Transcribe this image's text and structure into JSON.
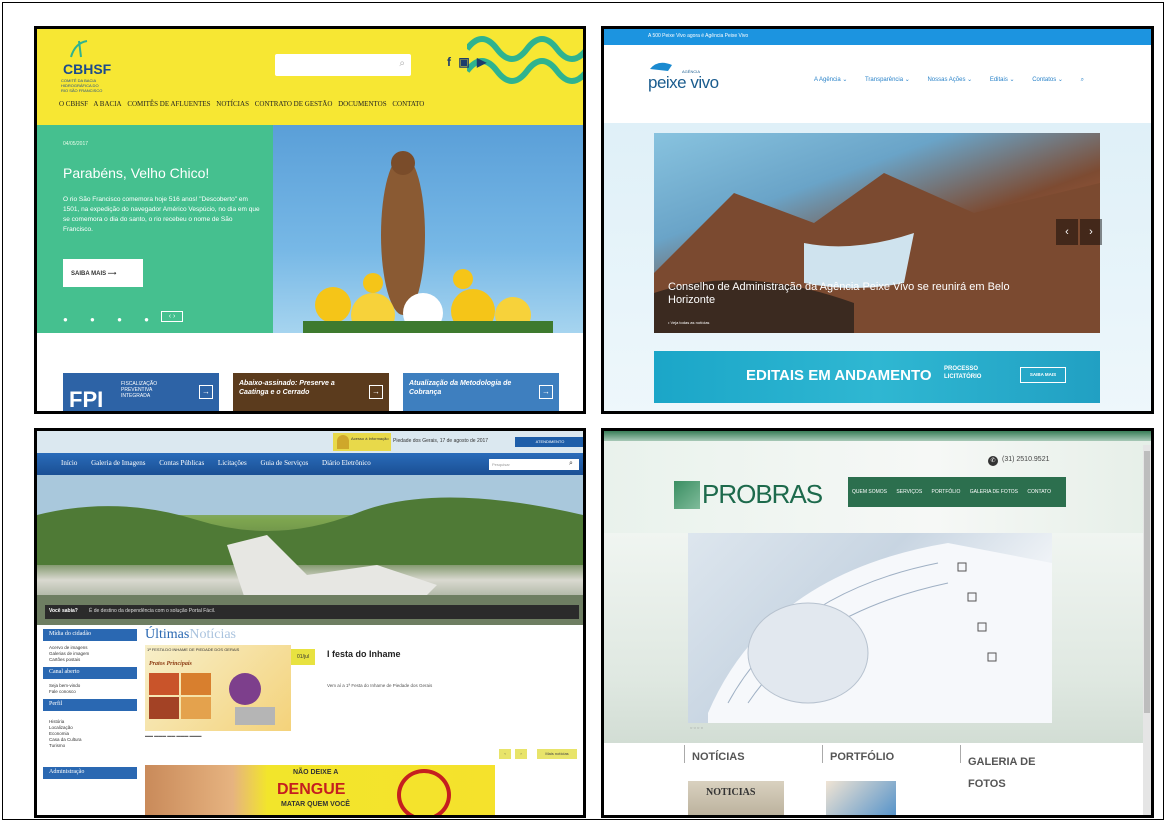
{
  "cbhsf": {
    "logo": "CBHSF",
    "logo_sub": "COMITÊ DA BACIA HIDROGRÁFICA DO RIO SÃO FRANCISCO",
    "social": "f ▣ ▶",
    "nav": [
      "O CBHSF",
      "A BACIA",
      "COMITÊS DE AFLUENTES",
      "NOTÍCIAS",
      "CONTRATO DE GESTÃO",
      "DOCUMENTOS",
      "CONTATO"
    ],
    "slide_date": "04/05/2017",
    "slide_title": "Parabéns, Velho Chico!",
    "slide_text": "O rio São Francisco comemora hoje 516 anos! \"Descoberto\" em 1501, na expedição do navegador Américo Vespúcio, no dia em que se comemora o dia do santo, o rio recebeu o nome de São Francisco.",
    "slide_button": "SAIBA MAIS",
    "slide_dots": "● ● ● ●",
    "slide_arrows": "‹ ›",
    "card1_big": "FPI",
    "card1_small": "FISCALIZAÇÃO PREVENTIVA INTEGRADA",
    "card2_text": "Abaixo-assinado: Preserve a Caatinga e o Cerrado",
    "card3_text": "Atualização da Metodologia de Cobrança"
  },
  "peixevivo": {
    "topbar": "A 500 Peixe Vivo agora é Agência Peixe Vivo",
    "logo_small": "AGÊNCIA",
    "logo": "peixe vivo",
    "nav": [
      "A Agência ⌄",
      "Transparência ⌄",
      "Nossas Ações ⌄",
      "Editais ⌄",
      "Contatos ⌄",
      "⌕"
    ],
    "slide_caption": "Conselho de Administração da Agência Peixe Vivo se reunirá em Belo Horizonte",
    "slide_link": "• Veja todas as notícias",
    "banner_title": "EDITAIS EM ANDAMENTO",
    "banner_sub": "PROCESSO LICITATÓRIO",
    "banner_button": "SAIBA MAIS"
  },
  "piedade": {
    "badge": "Acesso à Informação",
    "date": "Piedade dos Gerais, 17 de agosto de 2017",
    "attend": "ATENDIMENTO",
    "nav": [
      "Início",
      "Galeria de Imagens",
      "Contas Públicas",
      "Licitações",
      "Guia de Serviços",
      "Diário Eletrônico"
    ],
    "search_placeholder": "Pesquisar",
    "bar_question": "Você sabia?",
    "bar_text": "É de destino da dependência com o solução Portal Fácil.",
    "side": [
      {
        "title": "Mídia do cidadão",
        "items": [
          "Acervo de imagens",
          "Galerias de imagem",
          "Cartões postais"
        ]
      },
      {
        "title": "Canal aberto",
        "items": [
          "Seja bem-vindo",
          "Fale conosco"
        ]
      },
      {
        "title": "Perfil",
        "items": [
          "História",
          "Localização",
          "Economia",
          "Casa da Cultura",
          "Turismo"
        ]
      },
      {
        "title": "Administração",
        "items": []
      }
    ],
    "news_title_a": "Últimas",
    "news_title_b": "Notícias",
    "poster_title": "1ª FESTA DO INHAME DE PIEDADE DOS GERAIS",
    "poster_sub": "Pratos Principais",
    "dengue_btn": "01/jul",
    "news_headline": "I festa do Inhame",
    "news_text": "Vem aí a 1ª Festa do Inhame de Piedade dos Gerais",
    "logos": "▬▬ ▬▬▬ ▬▬ ▬▬▬ ▬▬▬",
    "pag_prev": "‹",
    "pag_next": "›",
    "pag_all": "Mais notícias",
    "ad_line1": "NÃO DEIXE A",
    "ad_line2": "DENGUE",
    "ad_line3": "MATAR QUEM VOCÊ"
  },
  "probras": {
    "phone": "(31) 2510.9521",
    "phone_icon": "phone-icon",
    "logo": "PROBRAS",
    "nav": [
      "QUEM SOMOS",
      "SERVIÇOS",
      "PORTFÓLIO",
      "GALERIA DE FOTOS",
      "CONTATO"
    ],
    "slide_dots": "○ ○ ○ ○",
    "sections": [
      "NOTÍCIAS",
      "PORTFÓLIO",
      "GALERIA DE FOTOS"
    ],
    "thumb_notice": "NOTICIAS"
  }
}
